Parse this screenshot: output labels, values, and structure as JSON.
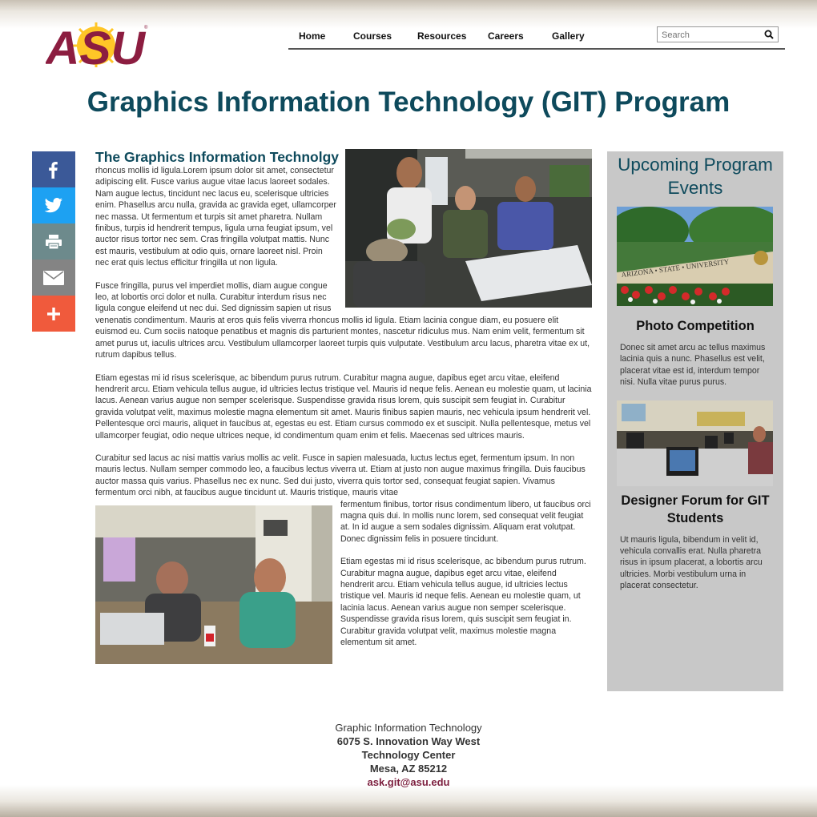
{
  "brand": {
    "logo_text": "ASU",
    "colors": {
      "maroon": "#8c1d40",
      "gold": "#ffc627",
      "teal": "#0e4a5c",
      "sidebar_bg": "#c8c8c8"
    }
  },
  "nav": {
    "items": [
      "Home",
      "Courses",
      "Resources",
      "Careers",
      "Gallery"
    ]
  },
  "search": {
    "placeholder": "Search",
    "icon": "search-icon"
  },
  "page": {
    "title": "Graphics Information Technology (GIT) Program"
  },
  "share": {
    "icons": [
      "facebook-icon",
      "twitter-icon",
      "print-icon",
      "email-icon",
      "more-icon"
    ],
    "colors": [
      "#3b5998",
      "#1da1f2",
      "#6d8a8c",
      "#848484",
      "#f05a3c"
    ]
  },
  "main": {
    "heading": "The Graphics Information Technolgy",
    "paragraphs": [
      "rhoncus mollis id ligula.Lorem ipsum dolor sit amet, consectetur adipiscing elit. Fusce varius augue vitae lacus laoreet sodales. Nam augue lectus, tincidunt nec lacus eu, scelerisque ultricies enim. Phasellus arcu nulla, gravida ac gravida eget, ullamcorper nec massa. Ut fermentum et turpis sit amet pharetra. Nullam finibus, turpis id hendrerit tempus, ligula urna feugiat ipsum, vel auctor risus tortor nec sem. Cras fringilla volutpat mattis. Nunc est mauris, vestibulum at odio quis, ornare laoreet nisl. Proin nec erat quis lectus efficitur fringilla ut non ligula.",
      "Fusce fringilla, purus vel imperdiet mollis, diam augue congue leo, at lobortis orci dolor et nulla. Curabitur interdum risus nec ligula congue eleifend ut nec dui. Sed dignissim sapien ut risus venenatis condimentum. Mauris at eros quis felis viverra rhoncus mollis id ligula. Etiam lacinia congue diam, eu posuere elit euismod eu. Cum sociis natoque penatibus et magnis dis parturient montes, nascetur ridiculus mus. Nam enim velit, fermentum sit amet purus ut, iaculis ultrices arcu. Vestibulum ullamcorper laoreet turpis quis vulputate. Vestibulum arcu lacus, pharetra vitae ex ut, rutrum dapibus tellus.",
      "Etiam egestas mi id risus scelerisque, ac bibendum purus rutrum. Curabitur magna augue, dapibus eget arcu vitae, eleifend hendrerit arcu. Etiam vehicula tellus augue, id ultricies lectus tristique vel. Mauris id neque felis. Aenean eu molestie quam, ut lacinia lacus. Aenean varius augue non semper scelerisque. Suspendisse gravida risus lorem, quis suscipit sem feugiat in. Curabitur gravida volutpat velit, maximus molestie magna elementum sit amet. Mauris finibus sapien mauris, nec vehicula ipsum hendrerit vel. Pellentesque orci mauris, aliquet in faucibus at, egestas eu est. Etiam cursus commodo ex et suscipit. Nulla pellentesque, metus vel ullamcorper feugiat, odio neque ultrices neque, id condimentum quam enim et felis. Maecenas sed ultrices mauris.",
      "Curabitur sed lacus ac nisi mattis varius mollis ac velit. Fusce in sapien malesuada, luctus lectus eget, fermentum ipsum. In non mauris lectus. Nullam semper commodo leo, a faucibus lectus viverra ut. Etiam at justo non augue maximus fringilla. Duis faucibus auctor massa quis varius. Phasellus nec ex nunc. Sed dui justo, viverra quis tortor sed, consequat feugiat sapien. Vivamus fermentum orci nibh, at faucibus augue tincidunt ut. Mauris tristique, mauris vitae",
      "fermentum finibus, tortor risus condimentum libero, ut faucibus orci magna quis dui. In mollis nunc lorem, sed consequat velit feugiat at. In id augue a sem sodales dignissim. Aliquam erat volutpat. Donec dignissim felis in posuere tincidunt.",
      "Etiam egestas mi id risus scelerisque, ac bibendum purus rutrum. Curabitur magna augue, dapibus eget arcu vitae, eleifend hendrerit arcu. Etiam vehicula tellus augue, id ultricies lectus tristique vel. Mauris id neque felis. Aenean eu molestie quam, ut lacinia lacus. Aenean varius augue non semper scelerisque. Suspendisse gravida risus lorem, quis suscipit sem feugiat in. Curabitur gravida volutpat velit, maximus molestie magna elementum sit amet."
    ]
  },
  "events": {
    "heading": "Upcoming Program Events",
    "items": [
      {
        "title": "Photo Competition",
        "image_sign": "ARIZONA • STATE • UNIVERSITY",
        "description": "Donec sit amet arcu ac tellus maximus lacinia quis a nunc. Phasellus est velit, placerat vitae est id, interdum tempor nisi. Nulla vitae purus purus."
      },
      {
        "title": "Designer Forum for GIT Students",
        "description": "Ut mauris ligula, bibendum in velit id, vehicula convallis erat. Nulla pharetra risus in ipsum placerat, a lobortis arcu ultricies. Morbi vestibulum urna in placerat consectetur."
      }
    ]
  },
  "footer": {
    "lines": [
      "Graphic Information Technology",
      "6075 S. Innovation Way West",
      "Technology Center",
      "Mesa, AZ 85212"
    ],
    "email": "ask.git@asu.edu"
  }
}
